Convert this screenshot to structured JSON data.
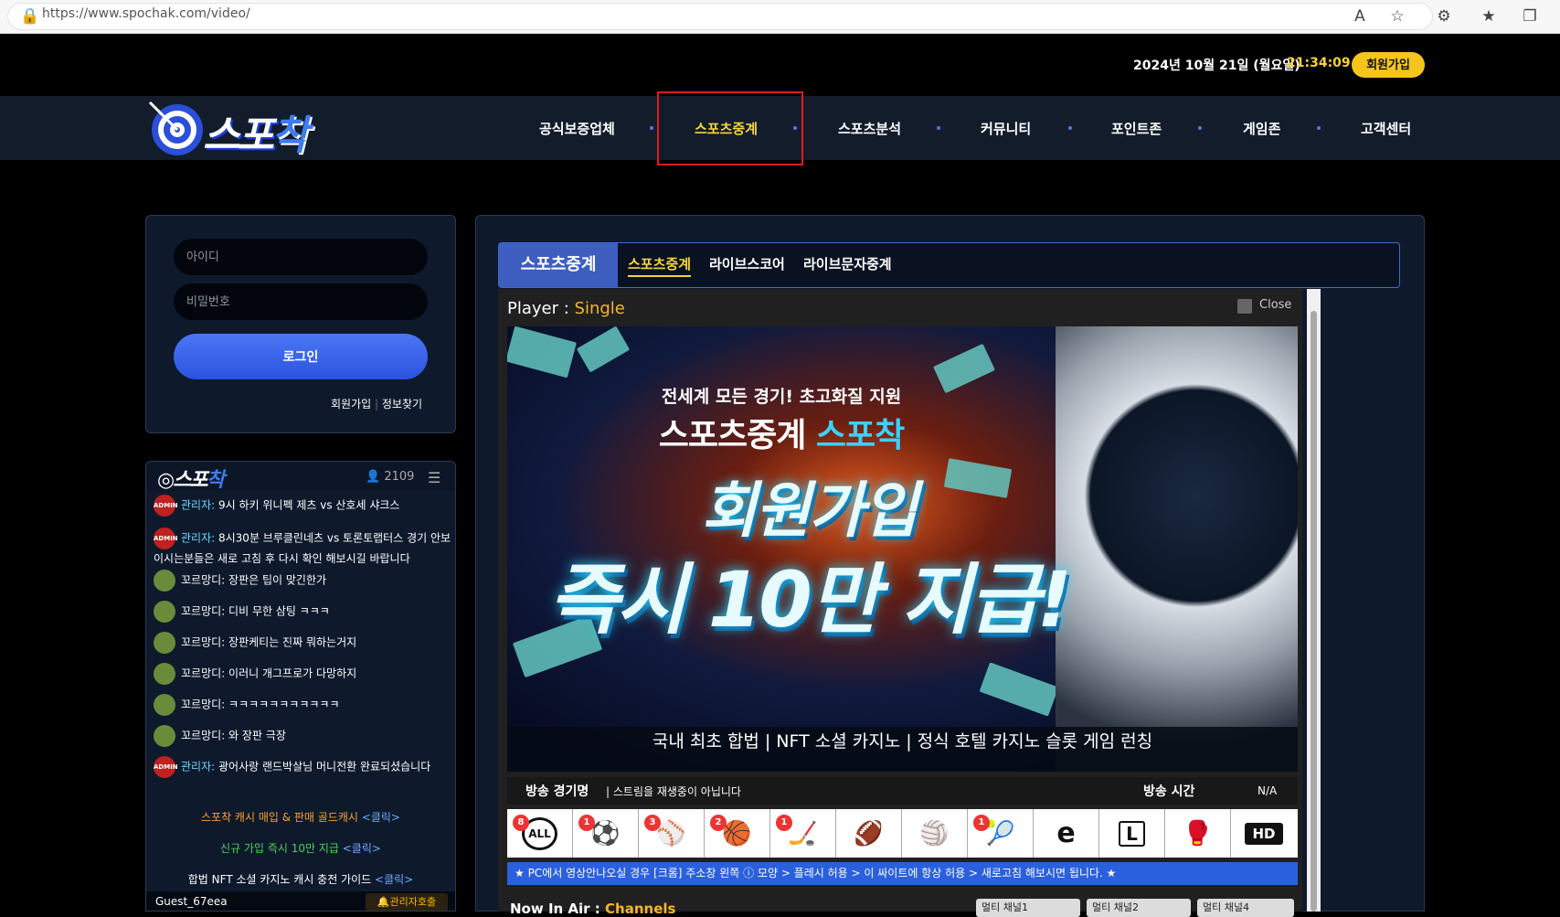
{
  "browser": {
    "url": "https://www.spochak.com/video/"
  },
  "header": {
    "date": "2024년 10월 21일 (월요일)",
    "time": "21:34:09",
    "join_label": "회원가입"
  },
  "logo": {
    "text_a": "스포",
    "text_b": "착"
  },
  "nav": {
    "items": [
      "공식보증업체",
      "스포츠중계",
      "스포츠분석",
      "커뮤니티",
      "포인트존",
      "게임존",
      "고객센터"
    ],
    "active": "스포츠중계"
  },
  "login": {
    "id_placeholder": "아이디",
    "pw_placeholder": "비밀번호",
    "login_label": "로그인",
    "join_link": "회원가입",
    "find_link": "정보찾기"
  },
  "chat": {
    "logo_a": "스포",
    "logo_b": "착",
    "user_count": "2109",
    "messages": [
      {
        "badge": "ADMIN",
        "nick": "관리자:",
        "text": "9시 하키 위니펙 제츠 vs 산호세 샤크스"
      },
      {
        "badge": "ADMIN",
        "nick": "관리자:",
        "text": "8시30분 브루클린네츠 vs 토론토랩터스 경기 안보이시는분들은 새로 고침 후 다시 확인 해보시길 바랍니다"
      },
      {
        "badge": "",
        "nick": "꼬르망디:",
        "text": "장판은 팁이 맞긴한가"
      },
      {
        "badge": "",
        "nick": "꼬르망디:",
        "text": "디비 무한 삼팅 ㅋㅋㅋ"
      },
      {
        "badge": "",
        "nick": "꼬르망디:",
        "text": "장판케티는 진짜 뭐하는거지"
      },
      {
        "badge": "",
        "nick": "꼬르망디:",
        "text": "이러니 개그프로가 다망하지"
      },
      {
        "badge": "",
        "nick": "꼬르망디:",
        "text": "ㅋㅋㅋㅋㅋㅋㅋㅋㅋㅋㅋ"
      },
      {
        "badge": "",
        "nick": "꼬르망디:",
        "text": "와 장판 극장"
      },
      {
        "badge": "ADMIN",
        "nick": "관리자:",
        "text": "광어사랑 랜드박살님 머니전환 완료되셨습니다"
      }
    ],
    "info1": "스포착 캐시 매입 & 판매 골드캐시",
    "info1_link": "<클릭>",
    "info2": "신규 가입 즉시 10만 지급",
    "info2_link": "<클릭>",
    "info3": "합법 NFT 소셜 카지노 캐시 충전 가이드",
    "info3_link": "<클릭>",
    "guest": "Guest_67eea",
    "admin_call": "관리자호출"
  },
  "main": {
    "title": "스포츠중계",
    "tabs": [
      "스포츠중계",
      "라이브스코어",
      "라이브문자중계"
    ],
    "player_label": "Player :",
    "player_mode": "Single",
    "close_label": "Close",
    "banner": {
      "line1": "전세계 모든 경기! 초고화질 지원",
      "line2a": "스포츠중계",
      "line2b": "스포착",
      "line3": "회원가입",
      "line4": "즉시 10만 지급!",
      "footer": "국내 최초 합법 | NFT 소셜 카지노 | 정식 호텔 카지노 슬롯 게임 런칭"
    },
    "info_label": "방송 경기명",
    "info_status": "| 스트림을 재생중이 아닙니다",
    "time_label": "방송 시간",
    "time_value": "N/A",
    "sports": [
      {
        "icon": "all-icon",
        "glyph": "ALL",
        "count": "8"
      },
      {
        "icon": "soccer-icon",
        "glyph": "⚽",
        "count": "1"
      },
      {
        "icon": "baseball-icon",
        "glyph": "⚾",
        "count": "3"
      },
      {
        "icon": "basketball-icon",
        "glyph": "🏀",
        "count": "2"
      },
      {
        "icon": "hockey-icon",
        "glyph": "🏒",
        "count": "1"
      },
      {
        "icon": "football-icon",
        "glyph": "🏈",
        "count": ""
      },
      {
        "icon": "volleyball-icon",
        "glyph": "🏐",
        "count": ""
      },
      {
        "icon": "tennis-icon",
        "glyph": "🎾",
        "count": "1"
      },
      {
        "icon": "esports-icon",
        "glyph": "e",
        "count": ""
      },
      {
        "icon": "lol-icon",
        "glyph": "L",
        "count": ""
      },
      {
        "icon": "ufc-icon",
        "glyph": "🥊",
        "count": ""
      },
      {
        "icon": "hd-icon",
        "glyph": "HD",
        "count": ""
      }
    ],
    "notice": "★ PC에서 영상안나오실 경우 [크롬] 주소창 왼쪽 ⓘ 모양 > 플레시 허용 > 이 싸이트에 항상 허용 > 새로고침 해보시면 됩니다. ★",
    "now_on_air_a": "Now In Air :",
    "now_on_air_b": "Channels",
    "multi": [
      "멀티 채널1",
      "멀티 채널2",
      "멀티 채널4"
    ]
  },
  "colors": {
    "accent_blue": "#3d5ebf",
    "gold": "#f5c51c",
    "highlight_red": "#e31b1b"
  }
}
